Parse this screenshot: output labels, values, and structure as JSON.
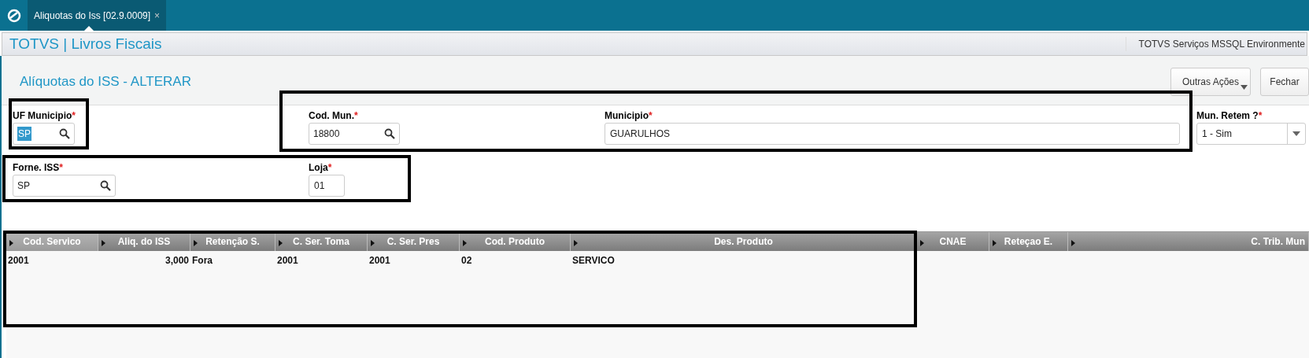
{
  "window": {
    "tab": {
      "label": "Aliquotas do Iss [02.9.0009]",
      "close": "×",
      "selected": true
    }
  },
  "app_bar": {
    "title": "TOTVS | Livros Fiscais",
    "environment": "TOTVS Serviços MSSQL Environmente"
  },
  "page": {
    "title": "Alíquotas do ISS - ALTERAR",
    "buttons": [
      {
        "label": "Outras Ações",
        "kind": "menu"
      },
      {
        "label": "Fechar",
        "kind": "plain"
      }
    ]
  },
  "form_rows": [
    {
      "fields": [
        {
          "label": "UF Municipio",
          "required_mark": "*",
          "kind": "lookup",
          "value": "SP",
          "value_selected": true
        },
        {
          "label": "Cod. Mun.",
          "required_mark": "*",
          "kind": "lookup",
          "value": "18800",
          "value_selected": false
        },
        {
          "label": "Municipio",
          "required_mark": "*",
          "kind": "text",
          "value": "GUARULHOS",
          "value_selected": false
        },
        {
          "label": "Mun. Retem ?",
          "required_mark": "*",
          "kind": "select",
          "value": "1 - Sim",
          "value_selected": false
        }
      ]
    },
    {
      "fields": [
        {
          "label": "Forne. ISS",
          "required_mark": "*",
          "kind": "lookup",
          "value": "SP",
          "value_selected": false
        },
        {
          "label": "Loja",
          "required_mark": "*",
          "kind": "short",
          "value": "01",
          "value_selected": false
        }
      ]
    }
  ],
  "table": {
    "columns": [
      {
        "label": "Cod. Servico",
        "selected": true
      },
      {
        "label": "Aliq. do ISS",
        "selected": false
      },
      {
        "label": "Retenção S.",
        "selected": false
      },
      {
        "label": "C. Ser. Toma",
        "selected": false
      },
      {
        "label": "C. Ser. Pres",
        "selected": false
      },
      {
        "label": "Cod. Produto",
        "selected": false
      },
      {
        "label": "Des. Produto",
        "selected": false
      },
      {
        "label": "CNAE",
        "selected": false
      },
      {
        "label": "Reteçao E.",
        "selected": false
      },
      {
        "label": "C. Trib. Mun",
        "selected": false
      }
    ],
    "rows": [
      [
        "2001",
        "3,000",
        "Fora",
        "2001",
        "2001",
        "02",
        "SERVICO",
        "",
        "",
        ""
      ]
    ]
  }
}
